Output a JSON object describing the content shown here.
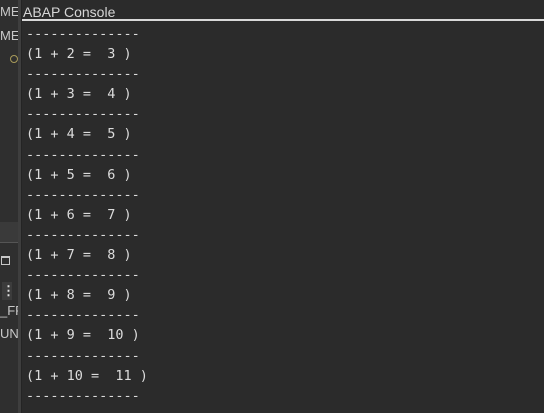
{
  "left_pane": {
    "fragments": [
      "ME",
      "ME",
      "_FR",
      "UN"
    ]
  },
  "console": {
    "title": "ABAP Console",
    "lines": [
      "--------------",
      "(1 + 2 =  3 )",
      "--------------",
      "(1 + 3 =  4 )",
      "--------------",
      "(1 + 4 =  5 )",
      "--------------",
      "(1 + 5 =  6 )",
      "--------------",
      "(1 + 6 =  7 )",
      "--------------",
      "(1 + 7 =  8 )",
      "--------------",
      "(1 + 8 =  9 )",
      "--------------",
      "(1 + 9 =  10 )",
      "--------------",
      "(1 + 10 =  11 )",
      "--------------"
    ]
  }
}
